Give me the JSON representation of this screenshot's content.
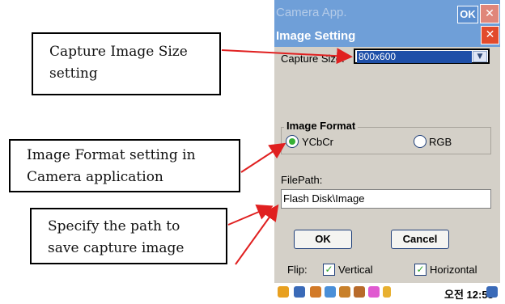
{
  "callouts": {
    "capture_size": [
      "Capture Image Size",
      "setting"
    ],
    "image_format": [
      "Image Format setting in",
      "Camera application"
    ],
    "file_path": [
      "Specify the path to",
      "save capture image"
    ]
  },
  "window": {
    "app_title": "Camera App.",
    "ok_label": "OK",
    "close_glyph": "✕"
  },
  "dialog": {
    "title": "Image Setting",
    "close_glyph": "✕",
    "capture_size_label": "Capture Size:",
    "capture_size_value": "800x600",
    "image_format_title": "Image Format",
    "formats": [
      {
        "label": "YCbCr",
        "selected": true
      },
      {
        "label": "RGB",
        "selected": false
      }
    ],
    "filepath_label": "FilePath:",
    "filepath_value": "Flash Disk\\Image",
    "ok_button": "OK",
    "cancel_button": "Cancel",
    "flip_label": "Flip:",
    "flip_options": [
      {
        "label": "Vertical",
        "checked": true
      },
      {
        "label": "Horizontal",
        "checked": true
      }
    ]
  },
  "taskbar": {
    "clock": "오전 12:53"
  },
  "colors": {
    "titlebar": "#6f9fd8",
    "close_red": "#e24a2c",
    "arrow_red": "#e02020",
    "radio_selected": "#36b035"
  }
}
